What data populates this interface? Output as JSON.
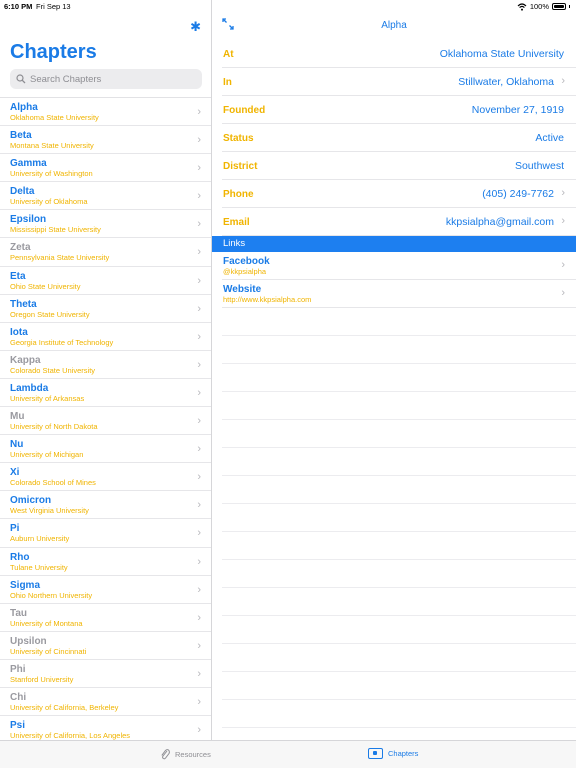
{
  "status_bar": {
    "time": "6:10 PM",
    "date": "Fri Sep 13",
    "battery": "100%",
    "icons": [
      "wifi-icon",
      "battery-icon"
    ]
  },
  "sidebar": {
    "title": "Chapters",
    "settings_icon": "gear-icon",
    "search": {
      "placeholder": "Search Chapters",
      "value": ""
    },
    "chapters": [
      {
        "name": "Alpha",
        "school": "Oklahoma State University",
        "active": true
      },
      {
        "name": "Beta",
        "school": "Montana State University",
        "active": true
      },
      {
        "name": "Gamma",
        "school": "University of Washington",
        "active": true
      },
      {
        "name": "Delta",
        "school": "University of Oklahoma",
        "active": true
      },
      {
        "name": "Epsilon",
        "school": "Mississippi State University",
        "active": true
      },
      {
        "name": "Zeta",
        "school": "Pennsylvania State University",
        "active": false
      },
      {
        "name": "Eta",
        "school": "Ohio State University",
        "active": true
      },
      {
        "name": "Theta",
        "school": "Oregon State University",
        "active": true
      },
      {
        "name": "Iota",
        "school": "Georgia Institute of Technology",
        "active": true
      },
      {
        "name": "Kappa",
        "school": "Colorado State University",
        "active": false
      },
      {
        "name": "Lambda",
        "school": "University of Arkansas",
        "active": true
      },
      {
        "name": "Mu",
        "school": "University of North Dakota",
        "active": false
      },
      {
        "name": "Nu",
        "school": "University of Michigan",
        "active": true
      },
      {
        "name": "Xi",
        "school": "Colorado School of Mines",
        "active": true
      },
      {
        "name": "Omicron",
        "school": "West Virginia University",
        "active": true
      },
      {
        "name": "Pi",
        "school": "Auburn University",
        "active": true
      },
      {
        "name": "Rho",
        "school": "Tulane University",
        "active": true
      },
      {
        "name": "Sigma",
        "school": "Ohio Northern University",
        "active": true
      },
      {
        "name": "Tau",
        "school": "University of Montana",
        "active": false
      },
      {
        "name": "Upsilon",
        "school": "University of Cincinnati",
        "active": false
      },
      {
        "name": "Phi",
        "school": "Stanford University",
        "active": false
      },
      {
        "name": "Chi",
        "school": "University of California, Berkeley",
        "active": false
      },
      {
        "name": "Psi",
        "school": "University of California, Los Angeles",
        "active": true
      }
    ]
  },
  "detail": {
    "title": "Alpha",
    "expand_icon": "expand-arrows-icon",
    "fields": [
      {
        "key": "at",
        "label": "At",
        "value": "Oklahoma State University",
        "chevron": false
      },
      {
        "key": "in",
        "label": "In",
        "value": "Stillwater, Oklahoma",
        "chevron": true
      },
      {
        "key": "founded",
        "label": "Founded",
        "value": "November 27, 1919",
        "chevron": false
      },
      {
        "key": "status",
        "label": "Status",
        "value": "Active",
        "chevron": false
      },
      {
        "key": "district",
        "label": "District",
        "value": "Southwest",
        "chevron": false
      },
      {
        "key": "phone",
        "label": "Phone",
        "value": "(405) 249-7762",
        "chevron": true
      },
      {
        "key": "email",
        "label": "Email",
        "value": "kkpsialpha@gmail.com",
        "chevron": true
      }
    ],
    "links_header": "Links",
    "links": [
      {
        "key": "facebook",
        "name": "Facebook",
        "sub": "@kkpsialpha"
      },
      {
        "key": "website",
        "name": "Website",
        "sub": "http://www.kkpsialpha.com"
      }
    ]
  },
  "tab_bar": {
    "tabs": [
      {
        "key": "resources",
        "label": "Resources",
        "icon": "paperclip-icon",
        "selected": false
      },
      {
        "key": "chapters",
        "label": "Chapters",
        "icon": "chapters-icon",
        "selected": true
      }
    ]
  },
  "colors": {
    "accent": "#1a7be6",
    "secondary": "#f0b400",
    "inactive": "#9a9aa0",
    "section_header": "#1d7ff0"
  }
}
